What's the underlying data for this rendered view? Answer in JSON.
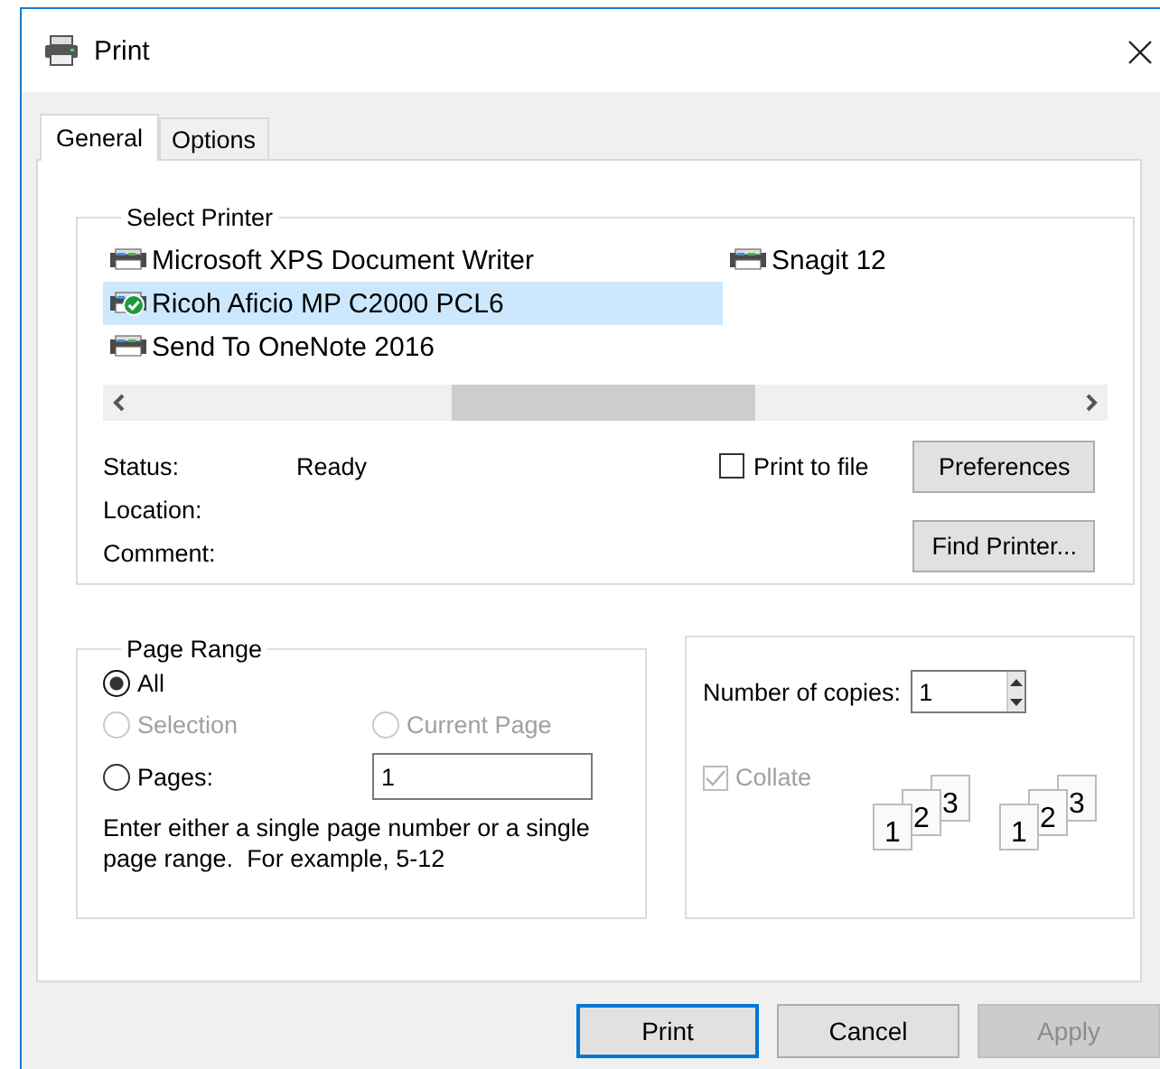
{
  "window": {
    "title": "Print"
  },
  "tabs": [
    {
      "label": "General",
      "selected": true
    },
    {
      "label": "Options",
      "selected": false
    }
  ],
  "select_printer": {
    "title": "Select Printer",
    "printers": [
      {
        "name": "Microsoft XPS Document Writer",
        "selected": false,
        "default": false
      },
      {
        "name": "Ricoh Aficio MP C2000 PCL6",
        "selected": true,
        "default": true
      },
      {
        "name": "Send To OneNote 2016",
        "selected": false,
        "default": false
      },
      {
        "name": "Snagit 12",
        "selected": false,
        "default": false
      }
    ],
    "status": {
      "label": "Status:",
      "value": "Ready"
    },
    "location": {
      "label": "Location:"
    },
    "comment": {
      "label": "Comment:"
    },
    "print_to_file": {
      "label": "Print to file",
      "checked": false
    },
    "buttons": [
      "Preferences",
      "Find Printer..."
    ]
  },
  "page_range": {
    "title": "Page Range",
    "options": [
      {
        "label": "All",
        "selected": true,
        "disabled": false
      },
      {
        "label": "Selection",
        "selected": false,
        "disabled": true
      },
      {
        "label": "Current Page",
        "selected": false,
        "disabled": true
      },
      {
        "label": "Pages:",
        "selected": false,
        "disabled": false
      }
    ],
    "pages_value": "1",
    "hint": "Enter either a single page number or a single page range.  For example, 5-12"
  },
  "copies": {
    "label": "Number of copies:",
    "value": "1",
    "collate": {
      "label": "Collate",
      "checked": true,
      "disabled": true
    },
    "collate_icons": [
      {
        "pages": [
          "1",
          "2",
          "3"
        ]
      },
      {
        "pages": [
          "1",
          "2",
          "3"
        ]
      }
    ]
  },
  "dialog_buttons": [
    {
      "label": "Print",
      "default": true,
      "disabled": false
    },
    {
      "label": "Cancel",
      "default": false,
      "disabled": false
    },
    {
      "label": "Apply",
      "default": false,
      "disabled": true
    }
  ]
}
